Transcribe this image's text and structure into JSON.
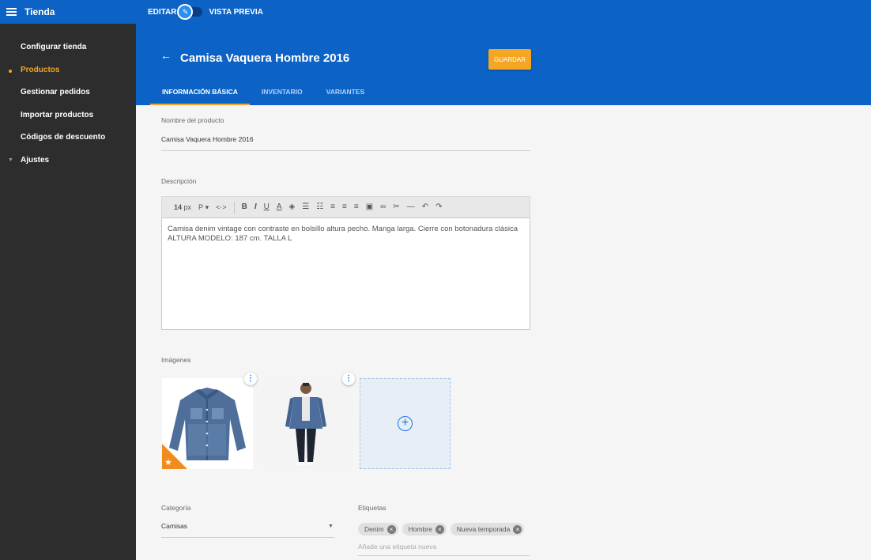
{
  "app": {
    "title": "Tienda",
    "mode_edit": "EDITAR",
    "mode_preview": "VISTA PREVIA"
  },
  "sidebar": {
    "items": [
      {
        "label": "Configurar tienda"
      },
      {
        "label": "Productos"
      },
      {
        "label": "Gestionar pedidos"
      },
      {
        "label": "Importar productos"
      },
      {
        "label": "Códigos de descuento"
      },
      {
        "label": "Ajustes"
      }
    ]
  },
  "header": {
    "back_icon": "←",
    "title": "Camisa Vaquera Hombre 2016",
    "save_label": "GUARDAR"
  },
  "tabs": [
    {
      "label": "INFORMACIÓN BÁSICA"
    },
    {
      "label": "INVENTARIO"
    },
    {
      "label": "VARIANTES"
    }
  ],
  "form": {
    "name_label": "Nombre del producto",
    "name_value": "Camisa Vaquera Hombre 2016",
    "description_label": "Descripción",
    "description_line1": "Camisa denim vintage con contraste en bolsillo altura pecho. Manga larga. Cierre con botonadura clásica",
    "description_line2": "ALTURA MODELO: 187 cm. TALLA L",
    "toolbar": {
      "font_size": "14",
      "font_unit": "px",
      "paragraph": "P"
    },
    "images_label": "Imágenes",
    "category_label": "Categoría",
    "category_value": "Camisas",
    "tags_label": "Etiquetas",
    "tags": [
      {
        "label": "Denim"
      },
      {
        "label": "Hombre"
      },
      {
        "label": "Nueva temporada"
      }
    ],
    "tag_placeholder": "Añade una etiqueta nueva"
  },
  "colors": {
    "primary": "#0d63c5",
    "accent": "#f5a623",
    "sidebar": "#2d2d2d"
  }
}
